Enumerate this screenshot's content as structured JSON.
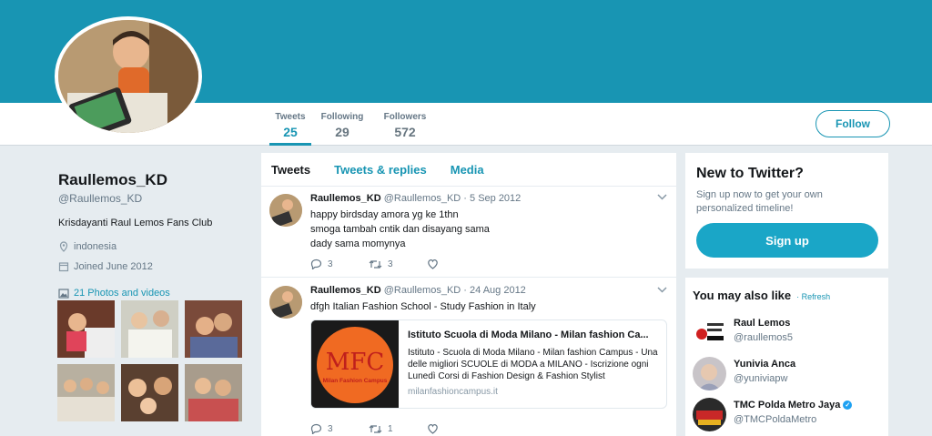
{
  "profile": {
    "name": "Raullemos_KD",
    "handle": "@Raullemos_KD",
    "bio": "Krisdayanti Raul Lemos Fans Club",
    "location": "indonesia",
    "joined": "Joined June 2012",
    "photos_link": "21 Photos and videos"
  },
  "nav": {
    "stats": [
      {
        "label": "Tweets",
        "value": "25"
      },
      {
        "label": "Following",
        "value": "29"
      },
      {
        "label": "Followers",
        "value": "572"
      }
    ],
    "follow_label": "Follow"
  },
  "feed": {
    "tabs": [
      "Tweets",
      "Tweets & replies",
      "Media"
    ],
    "tweets": [
      {
        "name": "Raullemos_KD",
        "handle": "@Raullemos_KD",
        "date": "· 5 Sep 2012",
        "lines": [
          "happy birdsday amora yg ke 1thn",
          "smoga tambah cntik dan disayang sama",
          "dady sama momynya"
        ],
        "replies": "3",
        "retweets": "3"
      },
      {
        "name": "Raullemos_KD",
        "handle": "@Raullemos_KD",
        "date": "· 24 Aug 2012",
        "lines": [
          "dfgh Italian Fashion School - Study Fashion in Italy"
        ],
        "card": {
          "title": "Istituto Scuola di Moda Milano - Milan fashion Ca...",
          "desc": "Istituto - Scuola di Moda Milano - Milan fashion Campus - Una delle migliori SCUOLE di MODA a MILANO - Iscrizione ogni Lunedì Corsi di Fashion Design & Fashion Stylist",
          "url": "milanfashioncampus.it",
          "logo_letters": "MFC",
          "logo_sub": "Milan Fashion Campus"
        },
        "replies": "3",
        "retweets": "1"
      }
    ]
  },
  "sidebar": {
    "new_title": "New to Twitter?",
    "new_text": "Sign up now to get your own personalized timeline!",
    "signup_label": "Sign up",
    "suggest_title": "You may also like",
    "refresh_label": "· Refresh",
    "suggestions": [
      {
        "name": "Raul Lemos",
        "handle": "@raullemos5"
      },
      {
        "name": "Yunivia Anca",
        "handle": "@yuniviapw"
      },
      {
        "name": "TMC Polda Metro Jaya",
        "handle": "@TMCPoldaMetro",
        "verified": true
      }
    ]
  },
  "colors": {
    "accent": "#1895b3",
    "banner": "#1895b3",
    "signup": "#1aa6c7"
  }
}
